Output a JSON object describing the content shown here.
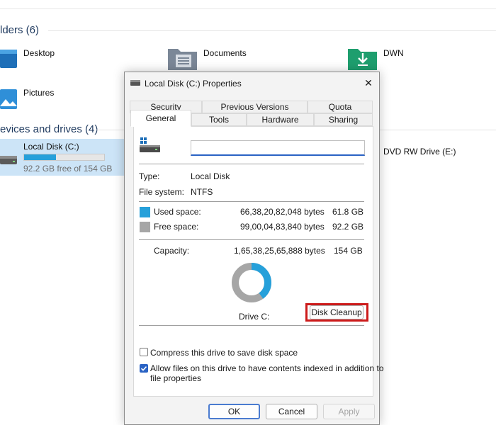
{
  "explorer": {
    "folders_title": "lders (6)",
    "devices_title": "evices and drives (4)",
    "folders": [
      {
        "label": "Desktop"
      },
      {
        "label": "Documents"
      },
      {
        "label": "DWN"
      },
      {
        "label": "Pictures"
      }
    ],
    "drive_c": {
      "label": "Local Disk (C:)",
      "free_text": "92.2 GB free of 154 GB",
      "used_fraction": 0.4
    },
    "dvd_label": "DVD RW Drive (E:)"
  },
  "dialog": {
    "title": "Local Disk (C:) Properties",
    "close_glyph": "✕",
    "tabs_top": [
      "Security",
      "Previous Versions",
      "Quota"
    ],
    "tabs_bottom": [
      "General",
      "Tools",
      "Hardware",
      "Sharing"
    ],
    "name_value": "",
    "type_label": "Type:",
    "type_value": "Local Disk",
    "fs_label": "File system:",
    "fs_value": "NTFS",
    "used_label": "Used space:",
    "used_bytes": "66,38,20,82,048 bytes",
    "used_gb": "61.8 GB",
    "free_label": "Free space:",
    "free_bytes": "99,00,04,83,840 bytes",
    "free_gb": "92.2 GB",
    "capacity_label": "Capacity:",
    "capacity_bytes": "1,65,38,25,65,888 bytes",
    "capacity_gb": "154 GB",
    "drive_caption": "Drive C:",
    "disk_cleanup": "Disk Cleanup",
    "compress_label": "Compress this drive to save disk space",
    "compress_checked": false,
    "index_label": "Allow files on this drive to have contents indexed in addition to",
    "index_label_line2": "file properties",
    "index_checked": true,
    "ok": "OK",
    "cancel": "Cancel",
    "apply": "Apply",
    "used_fraction": 0.4
  },
  "colors": {
    "used": "#26a0da",
    "free": "#a6a6a6",
    "highlight_box": "#cc1a1a",
    "accent": "#2a63c4"
  }
}
